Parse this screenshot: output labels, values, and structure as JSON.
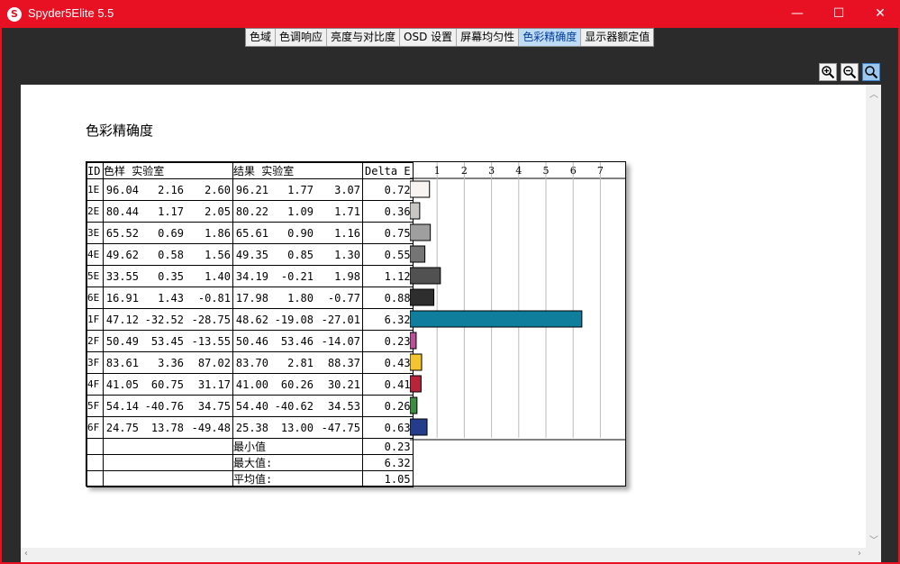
{
  "window": {
    "title": "Spyder5Elite 5.5",
    "icon_letter": "S"
  },
  "window_controls": {
    "minimize": "—",
    "maximize": "☐",
    "close": "✕"
  },
  "tabs": [
    {
      "label": "色域"
    },
    {
      "label": "色调响应"
    },
    {
      "label": "亮度与对比度"
    },
    {
      "label": "OSD 设置"
    },
    {
      "label": "屏幕均匀性"
    },
    {
      "label": "色彩精确度",
      "active": true
    },
    {
      "label": "显示器额定值"
    }
  ],
  "zoom_buttons": [
    "zoom-in-icon",
    "zoom-out-icon",
    "zoom-fit-icon"
  ],
  "page_title": "色彩精确度",
  "table": {
    "headers": {
      "id": "ID",
      "sample": "色样 实验室",
      "result": "结果 实验室",
      "delta": "Delta E"
    },
    "rows": [
      {
        "id": "1E",
        "sample": [
          "96.04",
          "2.16",
          "2.60"
        ],
        "result": [
          "96.21",
          "1.77",
          "3.07"
        ],
        "delta": "0.72",
        "color": "#f7f4f2"
      },
      {
        "id": "2E",
        "sample": [
          "80.44",
          "1.17",
          "2.05"
        ],
        "result": [
          "80.22",
          "1.09",
          "1.71"
        ],
        "delta": "0.36",
        "color": "#c8c6c5"
      },
      {
        "id": "3E",
        "sample": [
          "65.52",
          "0.69",
          "1.86"
        ],
        "result": [
          "65.61",
          "0.90",
          "1.16"
        ],
        "delta": "0.75",
        "color": "#a09f9f"
      },
      {
        "id": "4E",
        "sample": [
          "49.62",
          "0.58",
          "1.56"
        ],
        "result": [
          "49.35",
          "0.85",
          "1.30"
        ],
        "delta": "0.55",
        "color": "#767575"
      },
      {
        "id": "5E",
        "sample": [
          "33.55",
          "0.35",
          "1.40"
        ],
        "result": [
          "34.19",
          "-0.21",
          "1.98"
        ],
        "delta": "1.12",
        "color": "#515151"
      },
      {
        "id": "6E",
        "sample": [
          "16.91",
          "1.43",
          "-0.81"
        ],
        "result": [
          "17.98",
          "1.80",
          "-0.77"
        ],
        "delta": "0.88",
        "color": "#2f2e2f"
      },
      {
        "id": "1F",
        "sample": [
          "47.12",
          "-32.52",
          "-28.75"
        ],
        "result": [
          "48.62",
          "-19.08",
          "-27.01"
        ],
        "delta": "6.32",
        "color": "#0f7e9d"
      },
      {
        "id": "2F",
        "sample": [
          "50.49",
          "53.45",
          "-13.55"
        ],
        "result": [
          "50.46",
          "53.46",
          "-14.07"
        ],
        "delta": "0.23",
        "color": "#b9529a"
      },
      {
        "id": "3F",
        "sample": [
          "83.61",
          "3.36",
          "87.02"
        ],
        "result": [
          "83.70",
          "2.81",
          "88.37"
        ],
        "delta": "0.43",
        "color": "#f2c531"
      },
      {
        "id": "4F",
        "sample": [
          "41.05",
          "60.75",
          "31.17"
        ],
        "result": [
          "41.00",
          "60.26",
          "30.21"
        ],
        "delta": "0.41",
        "color": "#b8253b"
      },
      {
        "id": "5F",
        "sample": [
          "54.14",
          "-40.76",
          "34.75"
        ],
        "result": [
          "54.40",
          "-40.62",
          "34.53"
        ],
        "delta": "0.26",
        "color": "#3c8c43"
      },
      {
        "id": "6F",
        "sample": [
          "24.75",
          "13.78",
          "-49.48"
        ],
        "result": [
          "25.38",
          "13.00",
          "-47.75"
        ],
        "delta": "0.63",
        "color": "#243d8a"
      }
    ],
    "summary": [
      {
        "label": "最小值",
        "value": "0.23"
      },
      {
        "label": "最大值:",
        "value": "6.32"
      },
      {
        "label": "平均值:",
        "value": "1.05"
      }
    ]
  },
  "chart_data": {
    "type": "bar",
    "orientation": "horizontal",
    "categories": [
      "1E",
      "2E",
      "3E",
      "4E",
      "5E",
      "6E",
      "1F",
      "2F",
      "3F",
      "4F",
      "5F",
      "6F"
    ],
    "values": [
      0.72,
      0.36,
      0.75,
      0.55,
      1.12,
      0.88,
      6.32,
      0.23,
      0.43,
      0.41,
      0.26,
      0.63
    ],
    "xlim": [
      0,
      8
    ],
    "xticks": [
      "1",
      "2",
      "3",
      "4",
      "5",
      "6",
      "7"
    ],
    "grid": true
  }
}
